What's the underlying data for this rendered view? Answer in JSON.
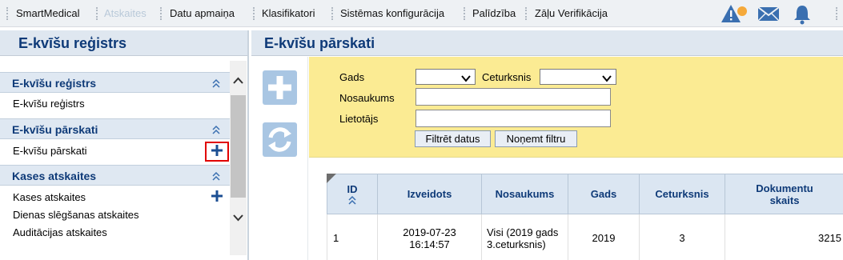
{
  "menu": {
    "items": [
      {
        "label": "SmartMedical"
      },
      {
        "label": "Atskaites"
      },
      {
        "label": "Datu apmaiņa"
      },
      {
        "label": "Klasifikatori"
      },
      {
        "label": "Sistēmas konfigurācija"
      },
      {
        "label": "Palīdzība"
      },
      {
        "label": "Zāļu Verifikācija"
      }
    ],
    "active_index": 1,
    "icons": [
      "warning-notification-icon",
      "mail-icon",
      "bell-icon"
    ]
  },
  "left_panel": {
    "title": "E-kvīšu reģistrs",
    "sections": [
      {
        "title": "E-kvīšu reģistrs",
        "items": [
          {
            "label": "E-kvīšu reģistrs",
            "has_add": false
          }
        ]
      },
      {
        "title": "E-kvīšu pārskati",
        "items": [
          {
            "label": "E-kvīšu pārskati",
            "has_add": true,
            "highlighted": true
          }
        ]
      },
      {
        "title": "Kases atskaites",
        "items": [
          {
            "label": "Kases atskaites",
            "has_add": true
          },
          {
            "label": "Dienas slēgšanas atskaites",
            "has_add": false
          },
          {
            "label": "Auditācijas atskaites",
            "has_add": false
          }
        ]
      }
    ]
  },
  "right_panel": {
    "title": "E-kvīšu pārskati",
    "toolbar": [
      "add-icon",
      "refresh-icon"
    ],
    "filters": {
      "gads_label": "Gads",
      "gads_value": "",
      "ceturksnis_label": "Ceturksnis",
      "ceturksnis_value": "",
      "nosaukums_label": "Nosaukums",
      "nosaukums_value": "",
      "lietotajs_label": "Lietotājs",
      "lietotajs_value": "",
      "filter_button": "Filtrēt datus",
      "clear_button": "Noņemt filtru"
    },
    "table": {
      "columns": [
        "ID",
        "Izveidots",
        "Nosaukums",
        "Gads",
        "Ceturksnis",
        "Dokumentu skaits"
      ],
      "rows": [
        {
          "id": "1",
          "created": "2019-07-23 16:14:57",
          "name": "Visi (2019 gads 3.ceturksnis)",
          "year": "2019",
          "quarter": "3",
          "doc_count": "3215"
        }
      ]
    }
  },
  "colors": {
    "accent": "#0e3a78",
    "filter_bg": "#fbeb93",
    "header_bg": "#dfe7f0",
    "highlight": "#e10000",
    "button_blue": "#a9c6e3"
  }
}
